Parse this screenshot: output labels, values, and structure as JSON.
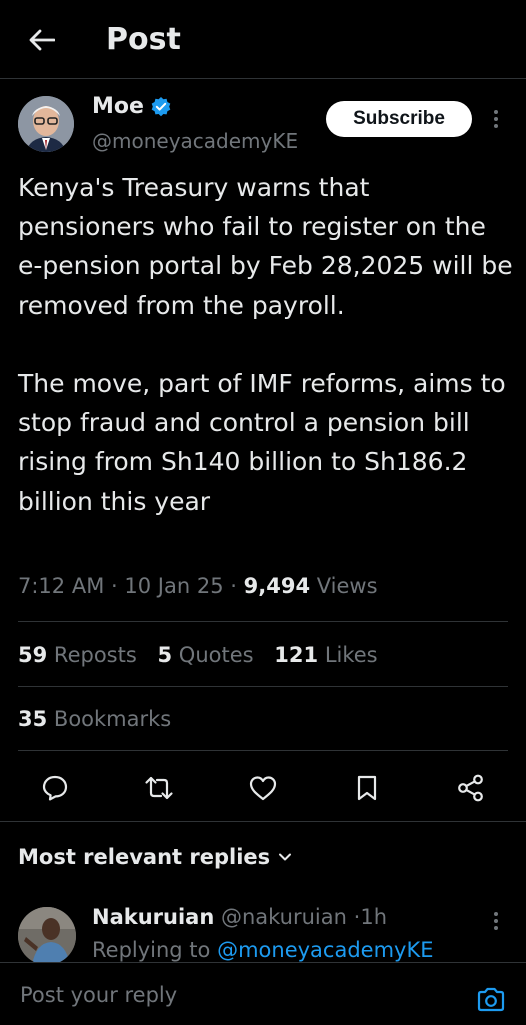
{
  "header": {
    "title": "Post"
  },
  "author": {
    "name": "Moe",
    "handle": "@moneyacademyKE",
    "subscribe_label": "Subscribe"
  },
  "post": {
    "text": "Kenya's Treasury warns that pensioners who fail to register on the e-pension portal by Feb 28,2025 will be removed from the payroll.\n\nThe move, part of IMF reforms, aims to stop fraud and control a pension bill rising from Sh140 billion to Sh186.2 billion this year",
    "time": "7:12 AM",
    "date": "10 Jan 25",
    "separator": "·",
    "views_count": "9,494",
    "views_label": "Views"
  },
  "stats": {
    "reposts_count": "59",
    "reposts_label": "Reposts",
    "quotes_count": "5",
    "quotes_label": "Quotes",
    "likes_count": "121",
    "likes_label": "Likes",
    "bookmarks_count": "35",
    "bookmarks_label": "Bookmarks"
  },
  "actions": [
    "reply-icon",
    "repost-icon",
    "like-icon",
    "bookmark-icon",
    "share-icon"
  ],
  "replies": {
    "sort_label": "Most relevant replies",
    "first": {
      "name": "Nakuruian",
      "handle": "@nakuruian",
      "time": "1h",
      "replying_prefix": "Replying to",
      "replying_to": "@moneyacademyKE"
    }
  },
  "composer": {
    "placeholder": "Post your reply"
  },
  "colors": {
    "accent": "#1d9bf0",
    "muted": "#71767b",
    "text": "#e7e9ea",
    "divider": "#2f3336"
  }
}
